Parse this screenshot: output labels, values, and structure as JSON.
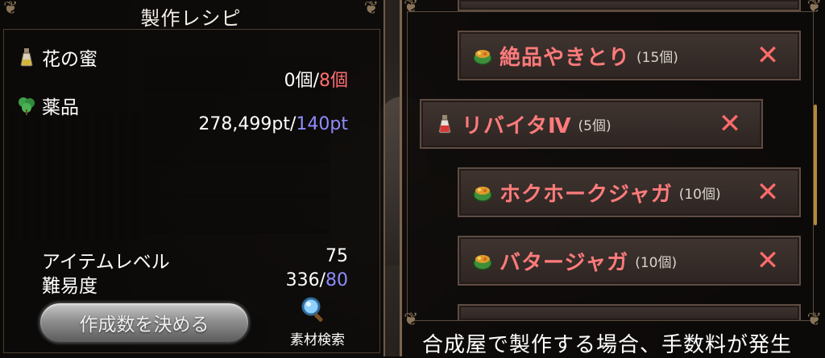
{
  "title": "製作レシピ",
  "materials": [
    {
      "name": "花の蜜",
      "icon": "potion-bottle-icon",
      "have": "0個",
      "sep": "/",
      "need": "8個",
      "need_color": "#ff6f6f"
    },
    {
      "name": "薬品",
      "icon": "herb-icon",
      "have": "278,499pt",
      "sep": "/",
      "need": "140pt",
      "need_color": "#8f8cff"
    }
  ],
  "stats": {
    "item_level_label": "アイテムレベル",
    "item_level_value": "75",
    "difficulty_label": "難易度",
    "difficulty_value": "336",
    "difficulty_sep": "/",
    "difficulty_max": "80"
  },
  "make_button": "作成数を決める",
  "search_label": "素材検索",
  "queue": [
    {
      "name": "絶品やきとり",
      "qty": "(15個)",
      "icon": "food-pot-icon"
    },
    {
      "name": "リバイタⅣ",
      "qty": "(5個)",
      "icon": "potion-bottle-icon"
    },
    {
      "name": "ホクホークジャガ",
      "qty": "(10個)",
      "icon": "food-pot-icon"
    },
    {
      "name": "バタージャガ",
      "qty": "(10個)",
      "icon": "food-pot-icon"
    }
  ],
  "remove_symbol": "✕",
  "footer": "合成屋で製作する場合、手数料が発生"
}
